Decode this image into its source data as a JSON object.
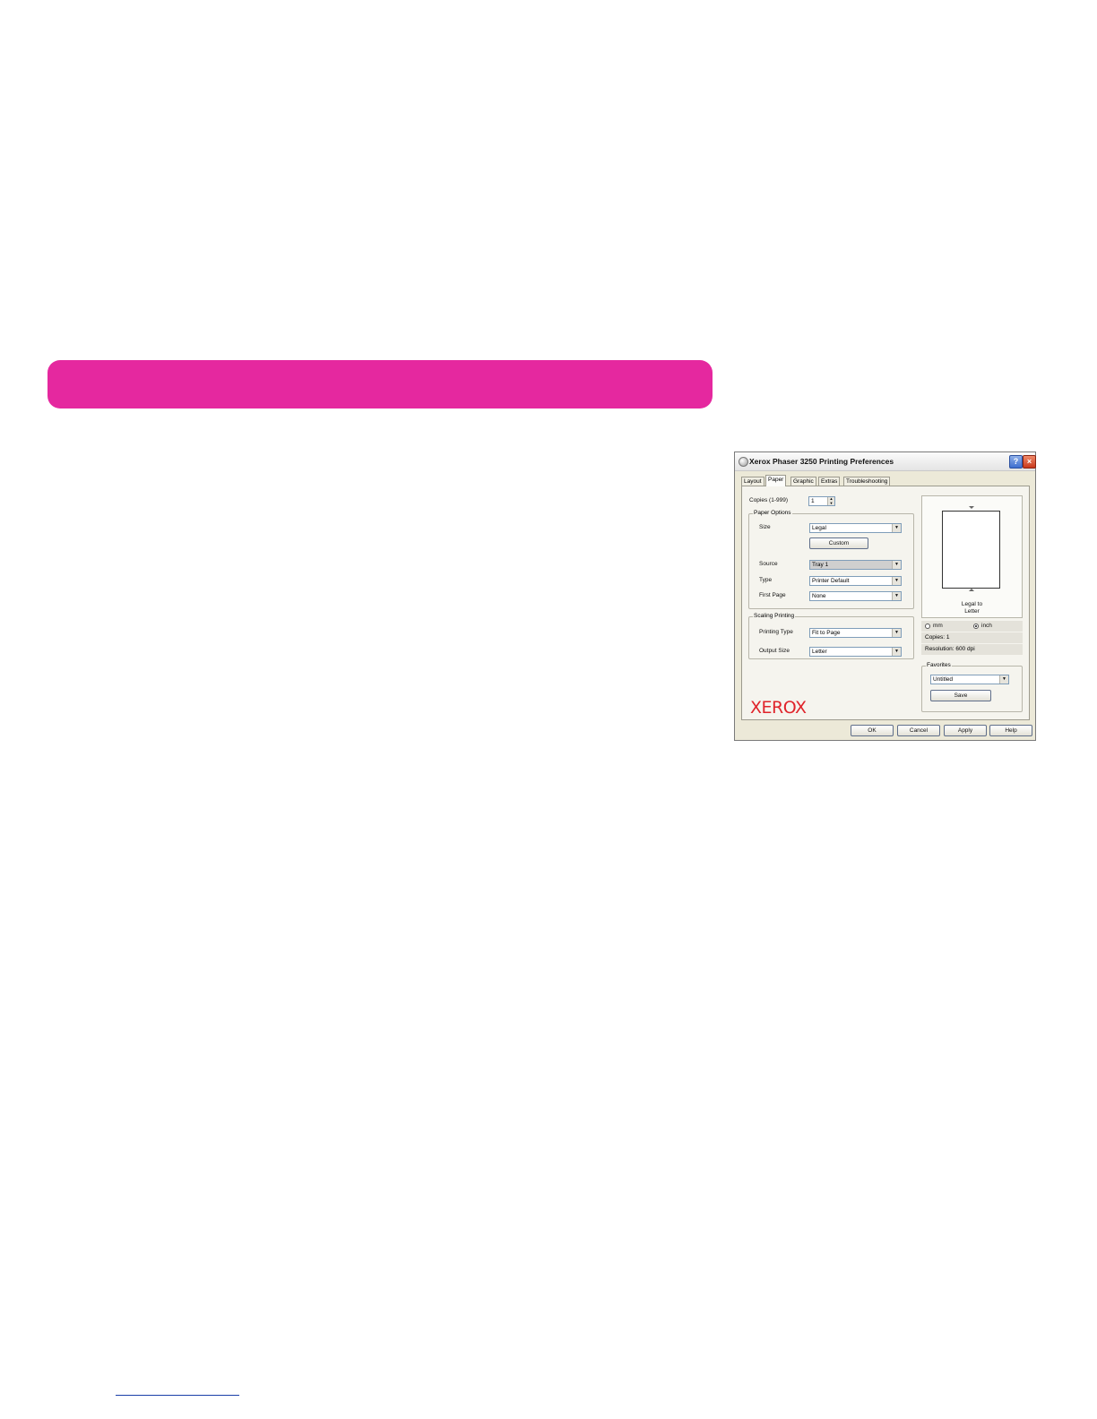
{
  "dialog": {
    "title": "Xerox Phaser 3250 Printing Preferences",
    "help_glyph": "?",
    "close_glyph": "×",
    "tabs": [
      {
        "label": "Layout",
        "active": false
      },
      {
        "label": "Paper",
        "active": true
      },
      {
        "label": "Graphic",
        "active": false
      },
      {
        "label": "Extras",
        "active": false
      },
      {
        "label": "Troubleshooting",
        "active": false
      }
    ],
    "copies": {
      "label": "Copies (1-999)",
      "value": "1"
    },
    "paper_options": {
      "title": "Paper Options",
      "size_label": "Size",
      "size_value": "Legal",
      "custom_button": "Custom",
      "source_label": "Source",
      "source_value": "Tray 1",
      "type_label": "Type",
      "type_value": "Printer Default",
      "first_page_label": "First Page",
      "first_page_value": "None"
    },
    "scaling": {
      "title": "Scaling Printing",
      "printing_type_label": "Printing Type",
      "printing_type_value": "Fit to Page",
      "output_size_label": "Output Size",
      "output_size_value": "Letter"
    },
    "preview": {
      "caption_line1": "Legal to",
      "caption_line2": "Letter",
      "unit_mm": "mm",
      "unit_inch": "inch",
      "selected_unit": "inch",
      "copies": "Copies: 1",
      "resolution": "Resolution: 600 dpi"
    },
    "favorites": {
      "title": "Favorites",
      "value": "Untitled",
      "save_button": "Save"
    },
    "logo": "XEROX",
    "buttons": {
      "ok": "OK",
      "cancel": "Cancel",
      "apply": "Apply",
      "help": "Help"
    },
    "dropdown_glyph": "▼",
    "spin_up": "▲",
    "spin_down": "▼"
  },
  "colors": {
    "accent_band": "#e5289f",
    "xerox_red": "#e0242b"
  }
}
